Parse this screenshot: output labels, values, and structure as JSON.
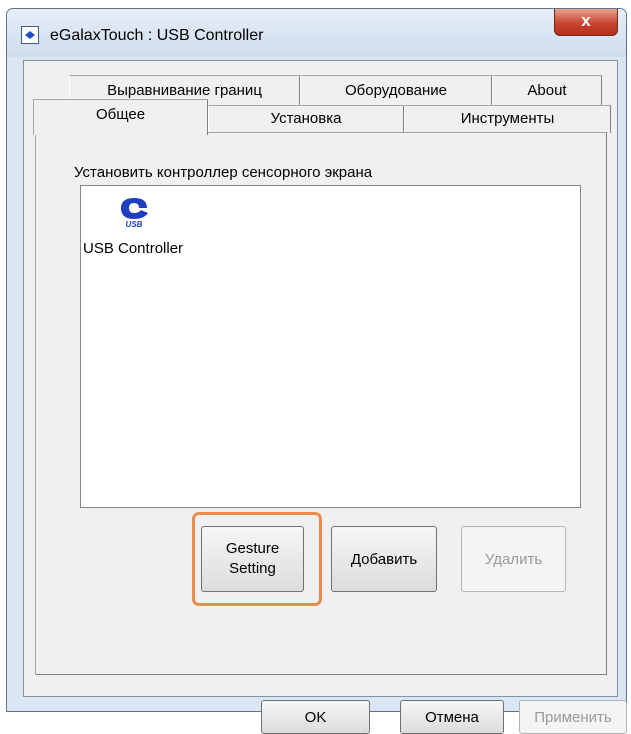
{
  "window": {
    "title": "eGalaxTouch : USB Controller",
    "close_symbol": "x"
  },
  "tabs": {
    "row_back": [
      "Выравнивание границ",
      "Оборудование",
      "About"
    ],
    "row_front": [
      "Общее",
      "Установка",
      "Инструменты"
    ],
    "active": "Общее"
  },
  "general_tab": {
    "section_label": "Установить контроллер сенсорного экрана",
    "devices": [
      {
        "label": "USB Controller",
        "icon": "usb-icon"
      }
    ],
    "buttons": {
      "gesture_setting": "Gesture\nSetting",
      "add": "Добавить",
      "remove": "Удалить"
    }
  },
  "dialog_buttons": {
    "ok": "OK",
    "cancel": "Отмена",
    "apply": "Применить"
  },
  "colors": {
    "highlight": "#f08a4b",
    "close_button": "#c9452f"
  }
}
